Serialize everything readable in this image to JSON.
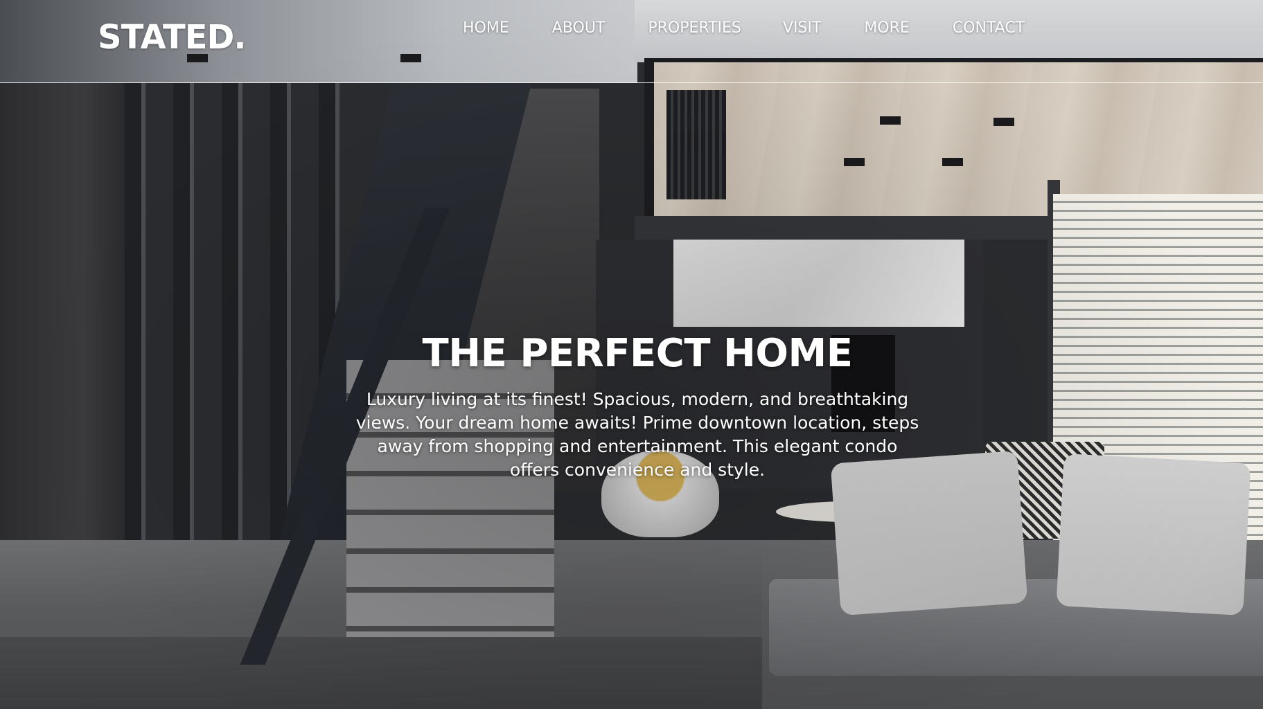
{
  "header": {
    "logo": "STATED.",
    "nav": [
      "HOME",
      "ABOUT",
      "PROPERTIES",
      "VISIT",
      "MORE",
      "CONTACT"
    ]
  },
  "hero": {
    "title": "THE PERFECT HOME",
    "description": "Luxury living at its finest! Spacious, modern, and breathtaking views. Your dream home awaits! Prime downtown location, steps away from shopping and entertainment. This elegant condo offers convenience and style."
  }
}
